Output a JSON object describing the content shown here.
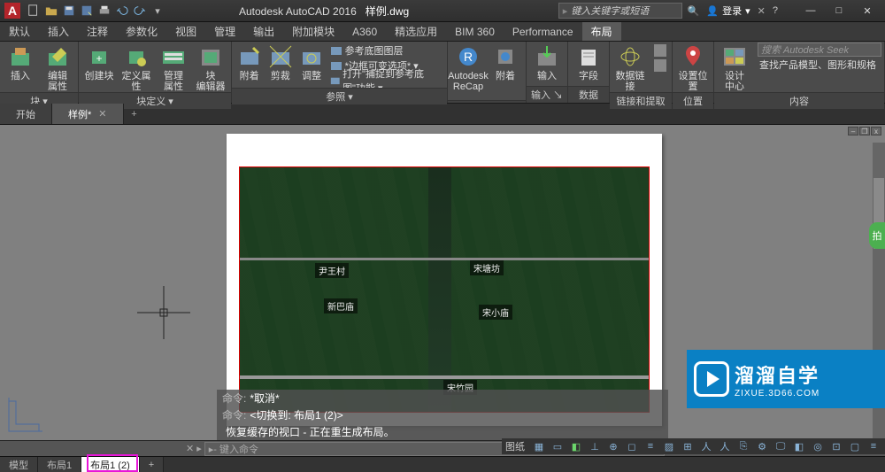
{
  "title": {
    "app": "Autodesk AutoCAD 2016",
    "doc": "样例.dwg"
  },
  "search": {
    "placeholder": "键入关键字或短语"
  },
  "login": {
    "label": "登录"
  },
  "menubar": [
    "默认",
    "插入",
    "注释",
    "参数化",
    "视图",
    "管理",
    "输出",
    "附加模块",
    "A360",
    "精选应用",
    "BIM 360",
    "Performance",
    "布局"
  ],
  "menubar_active": 12,
  "ribbon": {
    "panels": [
      {
        "label": "块 ▾",
        "big": [
          {
            "name": "insert",
            "text": "插入"
          },
          {
            "name": "edit-attr",
            "text": "编辑\n属性"
          }
        ]
      },
      {
        "label": "块定义 ▾",
        "big": [
          {
            "name": "create-block",
            "text": "创建块"
          },
          {
            "name": "def-attr",
            "text": "定义属性"
          },
          {
            "name": "manage-attr",
            "text": "管理\n属性"
          },
          {
            "name": "block-editor",
            "text": "块\n编辑器"
          }
        ]
      },
      {
        "label": "参照 ▾",
        "big": [
          {
            "name": "attach",
            "text": "附着"
          },
          {
            "name": "clip",
            "text": "剪裁"
          },
          {
            "name": "adjust",
            "text": "调整"
          }
        ],
        "rows": [
          {
            "name": "underlay-layers",
            "text": "参考底图图层"
          },
          {
            "name": "frame-vary",
            "text": "*边框可变选项* ▾"
          },
          {
            "name": "snap-underlay",
            "text": "打开\"捕捉到参考底图\"功能 ▾"
          }
        ]
      },
      {
        "label": "",
        "big": [
          {
            "name": "recap",
            "text": "Autodesk\nReCap"
          },
          {
            "name": "attach2",
            "text": "附着"
          }
        ]
      },
      {
        "label": "输入 ↘",
        "big": [
          {
            "name": "import",
            "text": "输入"
          }
        ]
      },
      {
        "label": "数据",
        "big": [
          {
            "name": "field",
            "text": "字段"
          }
        ]
      },
      {
        "label": "链接和提取",
        "big": [
          {
            "name": "data-link",
            "text": "数据链接"
          }
        ],
        "sideicons": [
          "table",
          "refresh"
        ]
      },
      {
        "label": "位置",
        "big": [
          {
            "name": "set-location",
            "text": "设置位置"
          }
        ]
      },
      {
        "label": "内容",
        "big": [
          {
            "name": "design-center",
            "text": "设计\n中心"
          }
        ],
        "seek_placeholder": "搜索 Autodesk Seek",
        "seek_sub": "查找产品模型、图形和规格"
      }
    ]
  },
  "doctabs": {
    "tabs": [
      "开始",
      "样例*"
    ],
    "active": 1
  },
  "viewport_labels": [
    {
      "l": 85,
      "t": 108,
      "text": "尹王村"
    },
    {
      "l": 260,
      "t": 105,
      "text": "宋塘坊"
    },
    {
      "l": 95,
      "t": 148,
      "text": "新巴庙"
    },
    {
      "l": 270,
      "t": 155,
      "text": "宋小庙"
    },
    {
      "l": 230,
      "t": 240,
      "text": "宋竹园"
    }
  ],
  "cmd_history": [
    {
      "prompt": "命令:",
      "text": "*取消*"
    },
    {
      "prompt": "命令:",
      "text": "<切换到: 布局1 (2)>"
    },
    {
      "prompt": "",
      "text": "恢复缓存的视口 - 正在重生成布局。"
    }
  ],
  "cmd_input": {
    "hint": "▸- 键入命令"
  },
  "layout_tabs": [
    "模型",
    "布局1",
    "布局1 (2)"
  ],
  "layout_active": 2,
  "status": {
    "label": "图纸"
  },
  "watermark": {
    "cn": "溜溜自学",
    "en": "ZIXUE.3D66.COM"
  }
}
